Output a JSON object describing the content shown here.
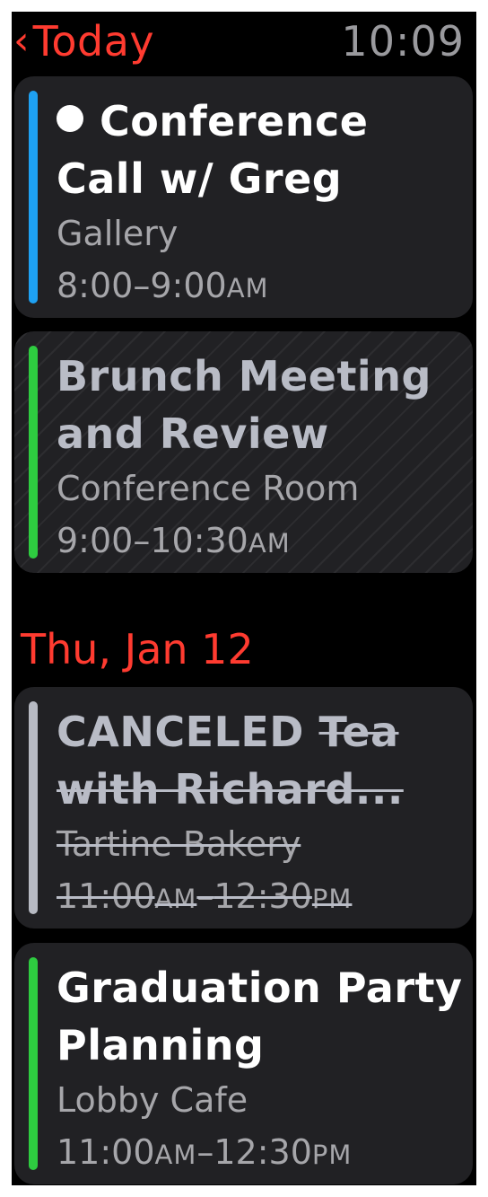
{
  "header": {
    "back_label": "Today",
    "time": "10:09"
  },
  "events_today": [
    {
      "title_line1": "Conference",
      "title_line2": "Call w/ Greg",
      "location": "Gallery",
      "time_start": "8:00",
      "time_sep": "–",
      "time_end": "9:00",
      "ampm_end": "AM",
      "bar_color": "#1ea1f3",
      "has_dot": true
    },
    {
      "title_line1": "Brunch Meeting",
      "title_line2": "and Review",
      "location": "Conference Room",
      "time_start": "9:00",
      "time_sep": "–",
      "time_end": "10:30",
      "ampm_end": "AM",
      "bar_color": "#2ecc40"
    }
  ],
  "section": {
    "date_label": "Thu, Jan 12"
  },
  "events_jan12": [
    {
      "status": "CANCELED",
      "title_part1": "Tea",
      "title_line2": "with Richard...",
      "location": "Tartine Bakery",
      "time_start": "11:00",
      "ampm_start": "AM",
      "time_sep": "–",
      "time_end": "12:30",
      "ampm_end": "PM",
      "bar_color": "#b7bac3"
    },
    {
      "title_line1": "Graduation Party",
      "title_line2": "Planning",
      "location": "Lobby Cafe",
      "time_start": "11:00",
      "ampm_start": "AM",
      "time_sep": "–",
      "time_end": "12:30",
      "ampm_end": "PM",
      "bar_color": "#2ecc40"
    }
  ]
}
